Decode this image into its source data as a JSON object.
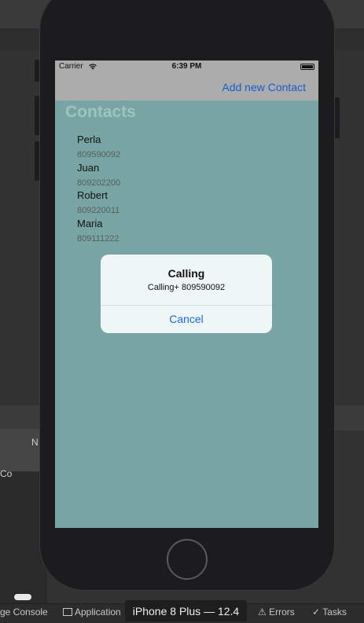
{
  "ide": {
    "left_panel_label": "Co",
    "left_panel_header": "N",
    "status_items": {
      "console": "ge Console",
      "application": "Application",
      "errors": "Errors",
      "tasks": "Tasks"
    },
    "device_tab": "iPhone 8 Plus — 12.4"
  },
  "device": {
    "status_bar": {
      "carrier": "Carrier",
      "time": "6:39 PM"
    },
    "nav": {
      "action_label": "Add new Contact",
      "title": "Contacts"
    },
    "contacts": [
      {
        "name": "Perla",
        "phone": "809590092"
      },
      {
        "name": "Juan",
        "phone": "809202200"
      },
      {
        "name": "Robert",
        "phone": "809220011"
      },
      {
        "name": "Maria",
        "phone": "809111222"
      }
    ],
    "alert": {
      "title": "Calling",
      "message": "Calling+ 809590092",
      "cancel_label": "Cancel"
    }
  },
  "colors": {
    "screen_background": "#78a5a3",
    "nav_background": "#acacac",
    "accent": "#1a6ae0"
  }
}
